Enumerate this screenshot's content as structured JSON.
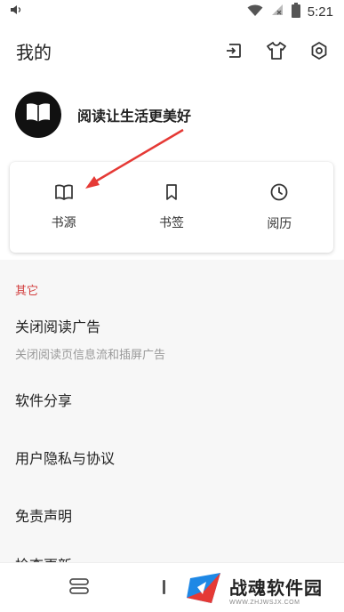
{
  "status_bar": {
    "time": "5:21",
    "icons": [
      "volume-icon",
      "wifi-icon",
      "no-sim-icon",
      "battery-icon"
    ]
  },
  "header": {
    "title": "我的",
    "actions": [
      "cast-icon",
      "theme-shirt-icon",
      "settings-icon"
    ]
  },
  "profile": {
    "slogan": "阅读让生活更美好",
    "avatar_icon": "open-book-icon"
  },
  "quick_actions": [
    {
      "label": "书源",
      "icon": "book-icon"
    },
    {
      "label": "书签",
      "icon": "bookmark-icon"
    },
    {
      "label": "阅历",
      "icon": "clock-icon"
    }
  ],
  "annotation": {
    "arrow_color": "#e53935"
  },
  "other": {
    "title": "其它",
    "items": [
      {
        "label": "关闭阅读广告",
        "sub": "关闭阅读页信息流和插屏广告"
      },
      {
        "label": "软件分享"
      },
      {
        "label": "用户隐私与协议"
      },
      {
        "label": "免责声明"
      },
      {
        "label": "检查更新"
      }
    ]
  },
  "bottom_nav": {
    "icons": [
      "bookshelf-icon",
      "discover-icon"
    ]
  },
  "watermark": {
    "text": "战魂软件园",
    "url": "WWW.ZHJWSJX.COM"
  },
  "colors": {
    "accent_red": "#d23c3c",
    "section_bg": "#f7f7f7",
    "text_primary": "#222222",
    "text_secondary": "#999999"
  }
}
